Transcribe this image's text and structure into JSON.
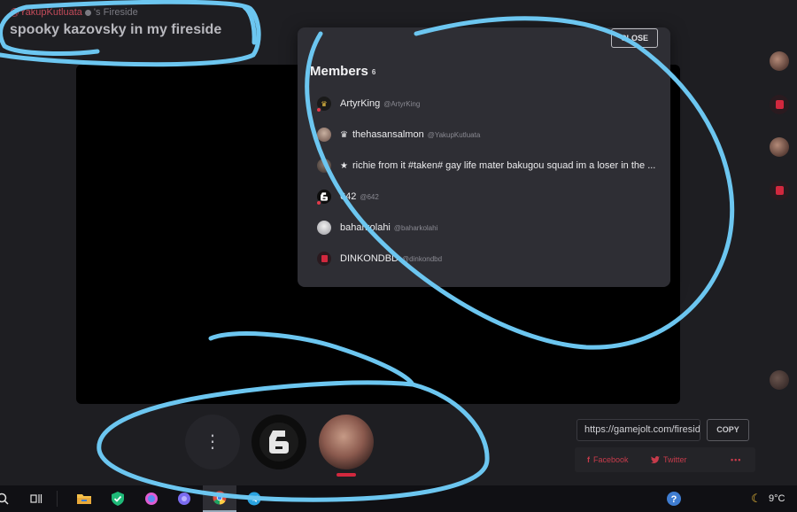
{
  "header": {
    "user": "@YakupKutluata",
    "suffix": "'s Fireside",
    "title": "spooky kazovsky in my fireside"
  },
  "members_popup": {
    "close_label": "CLOSE",
    "title": "Members",
    "count": "6",
    "members": [
      {
        "name": "ArtyrKing",
        "handle": "@ArtyrKing",
        "badge": "",
        "online": true,
        "avatar": "crown-avatar"
      },
      {
        "name": "thehasansalmon",
        "handle": "@YakupKutluata",
        "badge": "crown",
        "online": false,
        "avatar": "photo"
      },
      {
        "name": "richie from it #taken# gay life mater bakugou squad im a loser in the ...",
        "handle": "",
        "badge": "star",
        "online": false,
        "avatar": "photo"
      },
      {
        "name": "642",
        "handle": "@642",
        "badge": "",
        "online": true,
        "avatar": "six-logo"
      },
      {
        "name": "baharkolahi",
        "handle": "@baharkolahi",
        "badge": "",
        "online": false,
        "avatar": "photo"
      },
      {
        "name": "DINKONDBD",
        "handle": "@dinkondbd",
        "badge": "",
        "online": false,
        "avatar": "game-logo"
      }
    ]
  },
  "participant_bar": {
    "more_label": "⋮",
    "tiles": [
      "642",
      "host-camera"
    ]
  },
  "share": {
    "url": "https://gamejolt.com/fireside",
    "copy_label": "COPY",
    "facebook_label": "Facebook",
    "twitter_label": "Twitter",
    "more_label": "•••"
  },
  "taskbar": {
    "weather": "9°C"
  },
  "colors": {
    "accent_red": "#d2283e",
    "scribble_blue": "#6cc6f0",
    "popup_bg": "#2e2e34"
  }
}
